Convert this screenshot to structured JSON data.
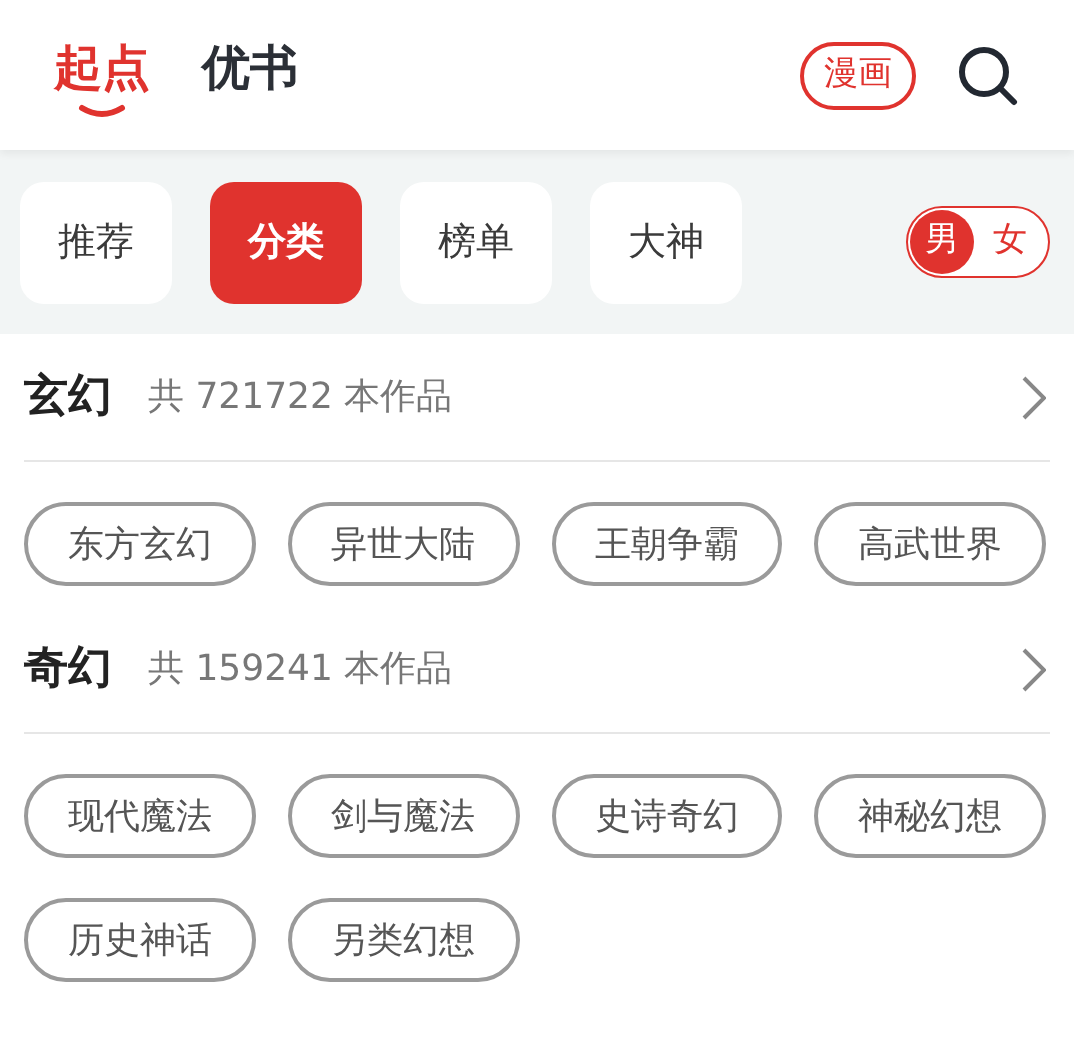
{
  "top_tabs": [
    {
      "label": "起点",
      "selected": true
    },
    {
      "label": "优书",
      "selected": false
    }
  ],
  "comic_button": "漫画",
  "sub_tabs": [
    {
      "label": "推荐",
      "selected": false
    },
    {
      "label": "分类",
      "selected": true
    },
    {
      "label": "榜单",
      "selected": false
    },
    {
      "label": "大神",
      "selected": false
    }
  ],
  "gender_toggle": [
    {
      "label": "男",
      "selected": true
    },
    {
      "label": "女",
      "selected": false
    }
  ],
  "categories": [
    {
      "title": "玄幻",
      "count": "共 721722 本作品",
      "tags": [
        "东方玄幻",
        "异世大陆",
        "王朝争霸",
        "高武世界"
      ]
    },
    {
      "title": "奇幻",
      "count": "共 159241 本作品",
      "tags": [
        "现代魔法",
        "剑与魔法",
        "史诗奇幻",
        "神秘幻想",
        "历史神话",
        "另类幻想"
      ]
    }
  ]
}
